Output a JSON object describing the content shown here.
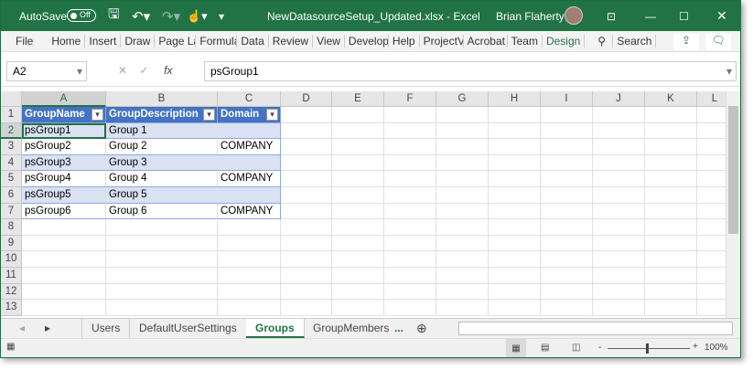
{
  "titlebar": {
    "autosave_label": "AutoSave",
    "autosave_state": "Off",
    "filename": "NewDatasourceSetup_Updated.xlsx",
    "separator": "-",
    "app": "Excel",
    "user": "Brian Flaherty",
    "accent": "#217346"
  },
  "ribbon": {
    "tabs": [
      "File",
      "Home",
      "Insert",
      "Draw",
      "Page La",
      "Formula",
      "Data",
      "Review",
      "View",
      "Develop",
      "Help",
      "ProjectV",
      "Acrobat",
      "Team",
      "Design"
    ],
    "active": "Design",
    "search": "Search"
  },
  "formula_bar": {
    "name_box": "A2",
    "fx": "fx",
    "value": "psGroup1"
  },
  "columns": [
    "A",
    "B",
    "C",
    "D",
    "E",
    "F",
    "G",
    "H",
    "I",
    "J",
    "K",
    "L"
  ],
  "rows": [
    1,
    2,
    3,
    4,
    5,
    6,
    7,
    8,
    9,
    10,
    11,
    12,
    13
  ],
  "table": {
    "headers": [
      "GroupName",
      "GroupDescription",
      "Domain"
    ],
    "rows": [
      [
        "psGroup1",
        "Group 1",
        ""
      ],
      [
        "psGroup2",
        "Group 2",
        "COMPANY"
      ],
      [
        "psGroup3",
        "Group 3",
        ""
      ],
      [
        "psGroup4",
        "Group 4",
        "COMPANY"
      ],
      [
        "psGroup5",
        "Group 5",
        ""
      ],
      [
        "psGroup6",
        "Group 6",
        "COMPANY"
      ]
    ],
    "header_color": "#4472c4",
    "band_color": "#d9e1f2"
  },
  "sheets": {
    "tabs": [
      "Users",
      "DefaultUserSettings",
      "Groups",
      "GroupMembers"
    ],
    "active": "Groups",
    "more": "..."
  },
  "status": {
    "zoom": "100%"
  }
}
